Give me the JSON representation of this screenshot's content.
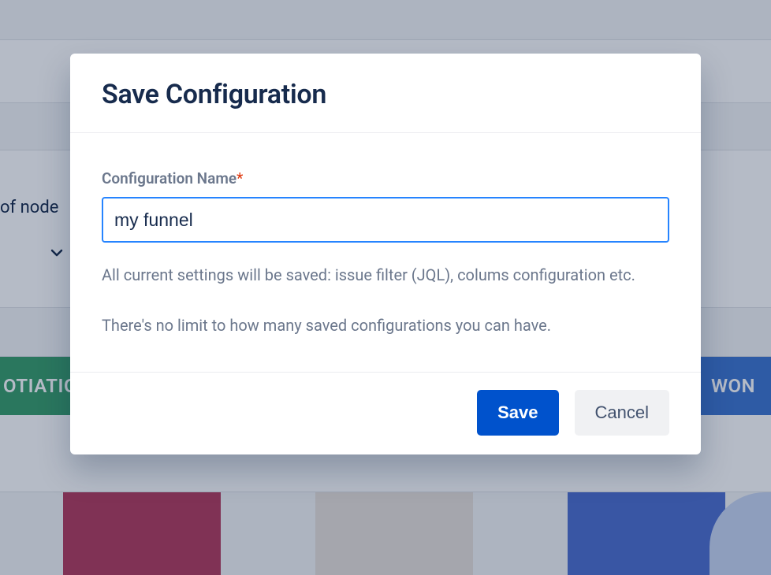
{
  "background": {
    "partial_label": "of node",
    "pill_left": "OTIATIO",
    "pill_right": "WON"
  },
  "modal": {
    "title": "Save Configuration",
    "field_label": "Configuration Name",
    "required_mark": "*",
    "input_value": "my funnel",
    "helper_line1": "All current settings will be saved: issue filter (JQL), colums configuration etc.",
    "helper_line2": "There's no limit to how many saved configurations you can have.",
    "save_label": "Save",
    "cancel_label": "Cancel"
  }
}
